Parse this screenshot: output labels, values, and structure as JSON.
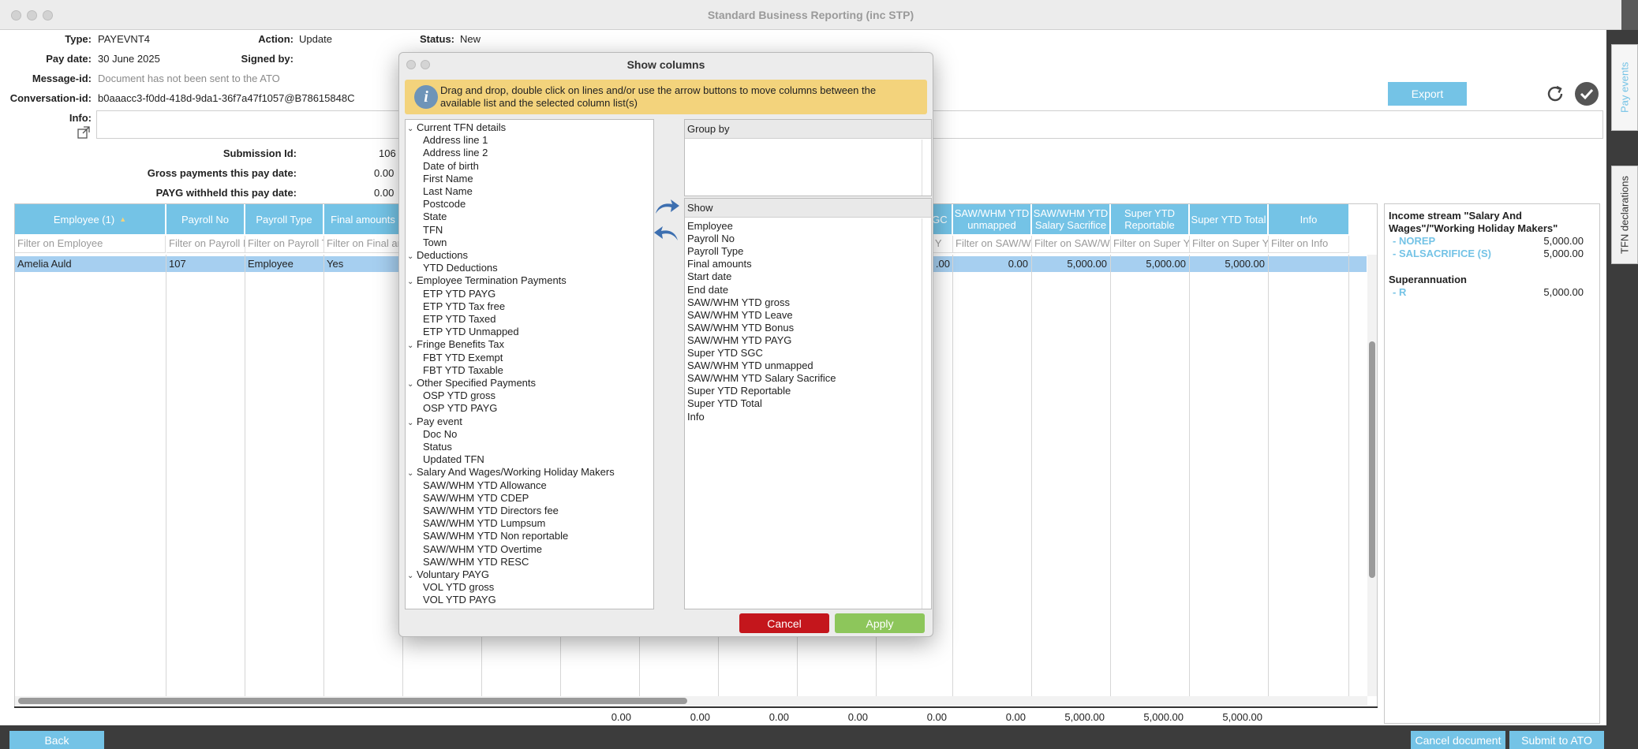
{
  "window": {
    "title": "Standard Business Reporting (inc STP)"
  },
  "header": {
    "type_label": "Type:",
    "type_value": "PAYEVNT4",
    "action_label": "Action:",
    "action_value": "Update",
    "status_label": "Status:",
    "status_value": "New",
    "paydate_label": "Pay date:",
    "paydate_value": "30 June 2025",
    "signedby_label": "Signed by:",
    "messageid_label": "Message-id:",
    "messageid_value": "Document has not been sent to the ATO",
    "convid_label": "Conversation-id:",
    "convid_value": "b0aaacc3-f0dd-418d-9da1-36f7a47f1057@B78615848C",
    "info_label": "Info:",
    "export_label": "Export"
  },
  "summary": {
    "submission_label": "Submission Id:",
    "submission_value": "106",
    "gross_label": "Gross payments this pay date:",
    "gross_value": "0.00",
    "payg_label": "PAYG withheld this pay date:",
    "payg_value": "0.00"
  },
  "grid": {
    "columns": [
      {
        "label": "Employee (1)",
        "filter": "Filter on Employee"
      },
      {
        "label": "Payroll No",
        "filter": "Filter on Payroll I"
      },
      {
        "label": "Payroll Type",
        "filter": "Filter on Payroll T"
      },
      {
        "label": "Final amounts",
        "filter": "Filter on Final an"
      },
      {
        "label": "SGC",
        "filter": "er Y"
      },
      {
        "label": "SAW/WHM YTD unmapped",
        "filter": "Filter on SAW/W"
      },
      {
        "label": "SAW/WHM YTD Salary Sacrifice",
        "filter": "Filter on SAW/W"
      },
      {
        "label": "Super YTD Reportable",
        "filter": "Filter on Super Y"
      },
      {
        "label": "Super YTD Total",
        "filter": "Filter on Super Y"
      },
      {
        "label": "Info",
        "filter": "Filter on Info"
      }
    ],
    "row": {
      "employee": "Amelia Auld",
      "payroll_no": "107",
      "payroll_type": "Employee",
      "final": "Yes",
      "sgc": ".00",
      "unmapped": "0.00",
      "salsac": "5,000.00",
      "reportable": "5,000.00",
      "total": "5,000.00"
    },
    "totals": [
      "0.00",
      "0.00",
      "0.00",
      "0.00",
      "0.00",
      "0.00",
      "5,000.00",
      "5,000.00",
      "5,000.00"
    ]
  },
  "side": {
    "income_title": "Income stream \"Salary And Wages\"/\"Working Holiday Makers\"",
    "items": [
      {
        "label": "- NOREP",
        "value": "5,000.00"
      },
      {
        "label": "- SALSACRIFICE (S)",
        "value": "5,000.00"
      }
    ],
    "super_title": "Superannuation",
    "super_items": [
      {
        "label": "- R",
        "value": "5,000.00"
      }
    ]
  },
  "tabs": {
    "pay_events": "Pay events",
    "tfn": "TFN declarations"
  },
  "footer": {
    "back": "Back",
    "cancel_doc": "Cancel document",
    "submit": "Submit to ATO"
  },
  "dialog": {
    "title": "Show columns",
    "banner": "Drag and drop, double click on lines and/or use the arrow buttons to move columns between the available list and the selected column list(s)",
    "available": [
      {
        "group": "Current TFN details",
        "items": [
          "Address line 1",
          "Address line 2",
          "Date of birth",
          "First Name",
          "Last Name",
          "Postcode",
          "State",
          "TFN",
          "Town"
        ]
      },
      {
        "group": "Deductions",
        "items": [
          "YTD Deductions"
        ]
      },
      {
        "group": "Employee Termination Payments",
        "items": [
          "ETP YTD PAYG",
          "ETP YTD Tax free",
          "ETP YTD Taxed",
          "ETP YTD Unmapped"
        ]
      },
      {
        "group": "Fringe Benefits Tax",
        "items": [
          "FBT YTD Exempt",
          "FBT YTD Taxable"
        ]
      },
      {
        "group": "Other Specified Payments",
        "items": [
          "OSP YTD gross",
          "OSP YTD PAYG"
        ]
      },
      {
        "group": "Pay event",
        "items": [
          "Doc No",
          "Status",
          "Updated TFN"
        ]
      },
      {
        "group": "Salary And Wages/Working Holiday Makers",
        "items": [
          "SAW/WHM YTD Allowance",
          "SAW/WHM YTD CDEP",
          "SAW/WHM YTD Directors fee",
          "SAW/WHM YTD Lumpsum",
          "SAW/WHM YTD Non reportable",
          "SAW/WHM YTD Overtime",
          "SAW/WHM YTD RESC"
        ]
      },
      {
        "group": "Voluntary PAYG",
        "items": [
          "VOL YTD gross",
          "VOL YTD PAYG"
        ]
      }
    ],
    "group_by": "Group by",
    "show": "Show",
    "selected": [
      "Employee",
      "Payroll No",
      "Payroll Type",
      "Final amounts",
      "Start date",
      "End date",
      "SAW/WHM YTD gross",
      "SAW/WHM YTD Leave",
      "SAW/WHM YTD Bonus",
      "SAW/WHM YTD PAYG",
      "Super YTD SGC",
      "SAW/WHM YTD unmapped",
      "SAW/WHM YTD Salary Sacrifice",
      "Super YTD Reportable",
      "Super YTD Total",
      "Info"
    ],
    "cancel": "Cancel",
    "apply": "Apply"
  }
}
